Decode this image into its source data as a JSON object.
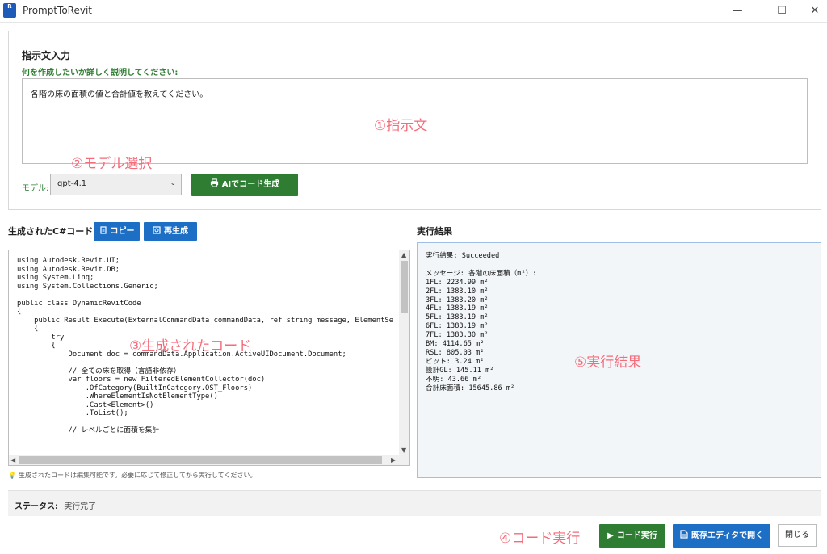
{
  "window": {
    "title": "PromptToRevit",
    "icon_text": "R",
    "controls": {
      "minimize": "—",
      "maximize": "☐",
      "close": "✕"
    }
  },
  "prompt_section": {
    "heading": "指示文入力",
    "instruction": "何を作成したいか詳しく説明してください:",
    "prompt_text": "各階の床の面積の値と合計値を教えてください。",
    "annotation": "①指示文"
  },
  "model": {
    "label": "モデル:",
    "selected": "gpt-4.1",
    "annotation": "②モデル選択"
  },
  "generate_button": {
    "label": "AIでコード生成",
    "icon": "printer-icon"
  },
  "code_section": {
    "heading": "生成されたC#コード",
    "copy_label": "コピー",
    "regenerate_label": "再生成",
    "annotation": "③生成されたコード",
    "code": "using Autodesk.Revit.UI;\nusing Autodesk.Revit.DB;\nusing System.Linq;\nusing System.Collections.Generic;\n\npublic class DynamicRevitCode\n{\n    public Result Execute(ExternalCommandData commandData, ref string message, ElementSe\n    {\n        try\n        {\n            Document doc = commandData.Application.ActiveUIDocument.Document;\n\n            // 全ての床を取得（言語非依存）\n            var floors = new FilteredElementCollector(doc)\n                .OfCategory(BuiltInCategory.OST_Floors)\n                .WhereElementIsNotElementType()\n                .Cast<Element>()\n                .ToList();\n\n            // レベルごとに面積を集計",
    "hint": "生成されたコードは編集可能です。必要に応じて修正してから実行してください。"
  },
  "result_section": {
    "heading": "実行結果",
    "status_line": "実行結果: Succeeded",
    "message_line": "メッセージ: 各階の床面積（m²）:",
    "lines": [
      "1FL: 2234.99 m²",
      "2FL: 1383.10 m²",
      "3FL: 1383.20 m²",
      "4FL: 1383.19 m²",
      "5FL: 1383.19 m²",
      "6FL: 1383.19 m²",
      "7FL: 1383.30 m²",
      "BM: 4114.65 m²",
      "RSL: 805.03 m²",
      "ピット: 3.24 m²",
      "設計GL: 145.11 m²",
      "不明: 43.66 m²",
      "合計床面積: 15645.86 m²"
    ],
    "annotation": "⑤実行結果"
  },
  "status_bar": {
    "label": "ステータス:",
    "value": "実行完了"
  },
  "footer": {
    "annotation": "④コード実行",
    "run_label": "コード実行",
    "open_editor_label": "既存エディタで開く",
    "close_label": "閉じる"
  },
  "colors": {
    "accent_green": "#2e7d32",
    "accent_blue": "#1c6fc4",
    "annotation_pink": "#f46b7a"
  }
}
